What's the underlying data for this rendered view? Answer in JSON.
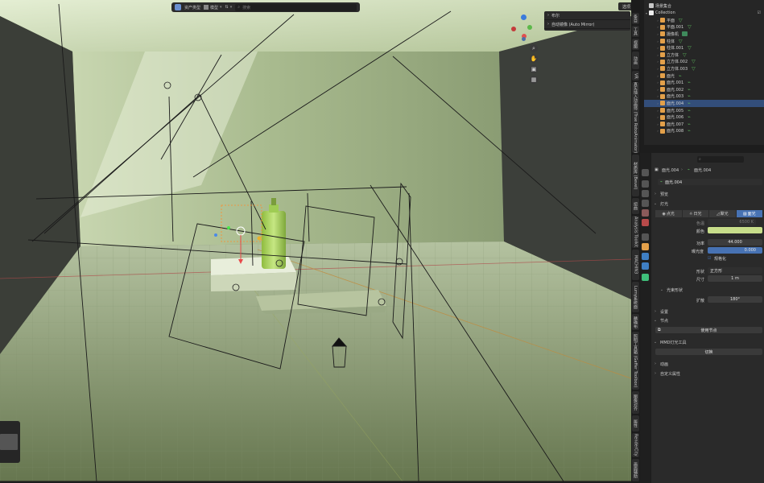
{
  "header": {
    "editor_type_label": "资产类型",
    "mode_label": "模型",
    "search_placeholder": "搜索",
    "options_label": "选项"
  },
  "viewport_sidepanel": {
    "items": [
      {
        "label": "布尔"
      },
      {
        "label": "自动镜像 (Auto Mirror)"
      }
    ]
  },
  "vertical_tabs": [
    "条目",
    "工具",
    "视图",
    "动画",
    "VR",
    "真实插入动画师 (True RoboAnimator)",
    "材质库 (Bevel)",
    "扭曲",
    "Analysis Toolkit",
    "MACHIN3",
    "Lumy系统面",
    "精确布",
    "照明工具箱 (Gaffer Toolbox)",
    "图像对齐",
    "属性",
    "RenderCity",
    "画面辅助"
  ],
  "outliner": {
    "root_label": "场景集合",
    "collection_label": "Collection",
    "items": [
      {
        "name": "平面",
        "kind": "mesh"
      },
      {
        "name": "平面.001",
        "kind": "mesh"
      },
      {
        "name": "摄像机",
        "kind": "camera"
      },
      {
        "name": "柱体",
        "kind": "mesh"
      },
      {
        "name": "柱体.001",
        "kind": "mesh"
      },
      {
        "name": "立方体",
        "kind": "mesh"
      },
      {
        "name": "立方体.002",
        "kind": "mesh"
      },
      {
        "name": "立方体.003",
        "kind": "mesh"
      },
      {
        "name": "面光",
        "kind": "light"
      },
      {
        "name": "面光.001",
        "kind": "light"
      },
      {
        "name": "面光.002",
        "kind": "light"
      },
      {
        "name": "面光.003",
        "kind": "light"
      },
      {
        "name": "面光.004",
        "kind": "light",
        "selected": true
      },
      {
        "name": "面光.005",
        "kind": "light"
      },
      {
        "name": "面光.006",
        "kind": "light"
      },
      {
        "name": "面光.007",
        "kind": "light"
      },
      {
        "name": "面光.008",
        "kind": "light"
      }
    ]
  },
  "properties": {
    "breadcrumb_object": "面光.004",
    "breadcrumb_data": "面光.004",
    "datablock_name": "面光.004",
    "sections": {
      "preview": "预览",
      "light": "灯光",
      "beam_shape": "光束形状",
      "settings": "设置",
      "nodes": "节点",
      "mmd_tools": "MMD灯光工具",
      "animation": "动画",
      "custom_props": "自定义属性"
    },
    "light_types": [
      "点光",
      "日光",
      "聚光",
      "面光"
    ],
    "active_light_type_index": 3,
    "temperature_label": "色温",
    "temperature_value": "6500 K",
    "color_label": "颜色",
    "color_hex": "#c7dd8a",
    "power_label": "功率",
    "power_value": "44.000",
    "exposure_label": "曝光度",
    "exposure_value": "0.000",
    "normalize_label": "规格化",
    "shape_label": "形状",
    "shape_value": "正方形",
    "size_label": "尺寸",
    "size_value": "1 m",
    "spread_label": "扩散",
    "spread_value": "180°",
    "use_nodes_label": "使用节点",
    "toggle_label": "切换"
  },
  "colors": {
    "accent": "#4772b3",
    "selected_row": "#334e7a",
    "viewport_floor": "#5d6a4e"
  }
}
